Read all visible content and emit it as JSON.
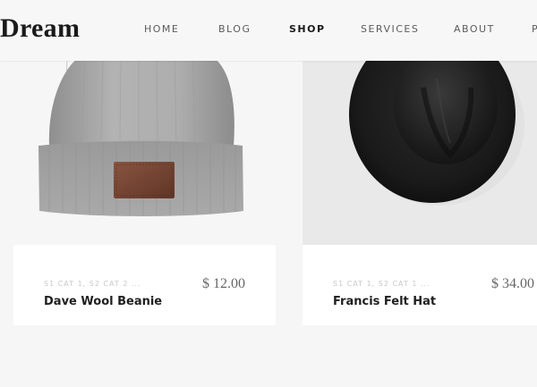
{
  "header": {
    "logo": "Dream",
    "nav": [
      {
        "label": "HOME",
        "active": false
      },
      {
        "label": "BLOG",
        "active": false
      },
      {
        "label": "SHOP",
        "active": true
      },
      {
        "label": "SERVICES",
        "active": false
      },
      {
        "label": "ABOUT",
        "active": false
      },
      {
        "label": "P",
        "active": false
      }
    ]
  },
  "products": [
    {
      "categories": "S1 CAT 1, S2 CAT 2 ...",
      "name": "Dave Wool Beanie",
      "price": "$ 12.00",
      "image_icon": "beanie-image"
    },
    {
      "categories": "S1 CAT 1, S2 CAT 1 ...",
      "name": "Francis Felt Hat",
      "price": "$ 34.00",
      "image_icon": "felt-hat-image"
    }
  ],
  "colors": {
    "background": "#f6f6f6",
    "header_bg": "#f7f7f7",
    "card_bg": "#ffffff",
    "title": "#1f1f1f",
    "muted": "#c8c8c8",
    "price": "#666666",
    "beanie_gray": "#a8a8a8",
    "leather_patch": "#7a4a35",
    "felt_black": "#1a1a1a"
  }
}
